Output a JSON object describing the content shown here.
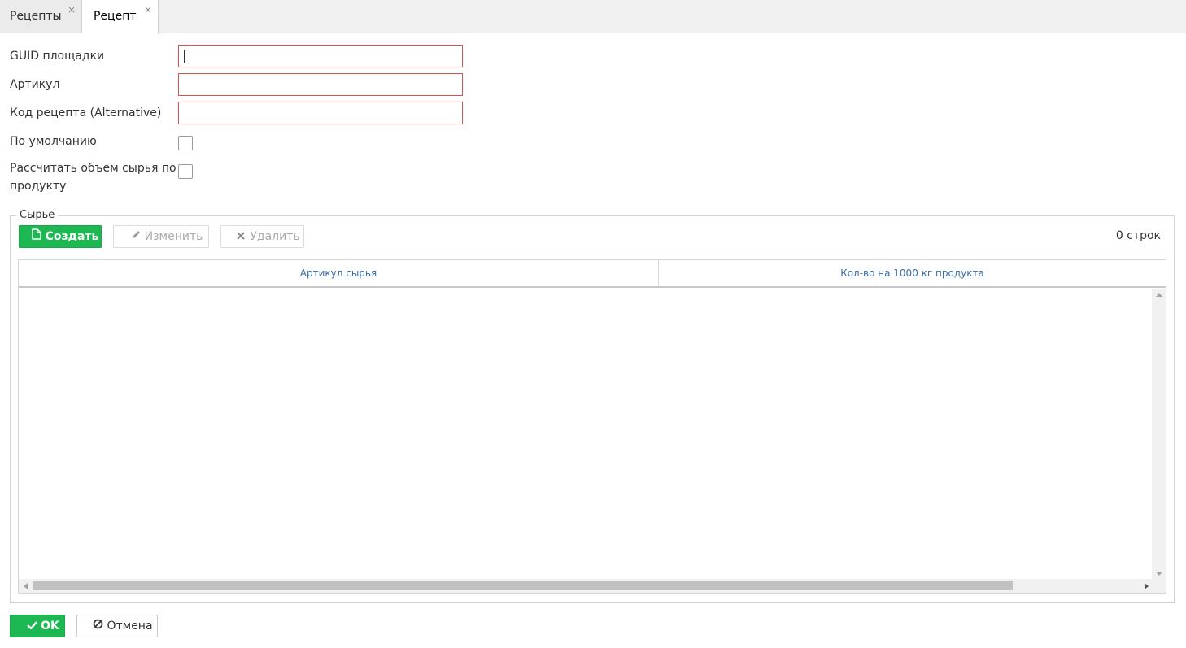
{
  "tabs": [
    {
      "label": "Рецепты",
      "close": "×"
    },
    {
      "label": "Рецепт",
      "close": "×"
    }
  ],
  "form": {
    "guid_label": "GUID площадки",
    "guid_value": "",
    "article_label": "Артикул",
    "article_value": "",
    "recipe_code_label": "Код рецепта (Alternative)",
    "recipe_code_value": "",
    "default_label": "По умолчанию",
    "default_checked": false,
    "calc_label_line1": "Рассчитать объем сырья по",
    "calc_label_line2": "продукту",
    "calc_checked": false
  },
  "raw_materials": {
    "legend": "Сырье",
    "create_label": "Создать",
    "edit_label": "Изменить",
    "delete_label": "Удалить",
    "row_count": "0 строк",
    "columns": [
      "Артикул сырья",
      "Кол-во на 1000 кг продукта"
    ],
    "rows": []
  },
  "footer": {
    "ok_label": "OK",
    "cancel_label": "Отмена"
  },
  "colors": {
    "accent_green": "#1eb853",
    "invalid_border": "#d9534f",
    "header_link": "#3a6ea5"
  }
}
